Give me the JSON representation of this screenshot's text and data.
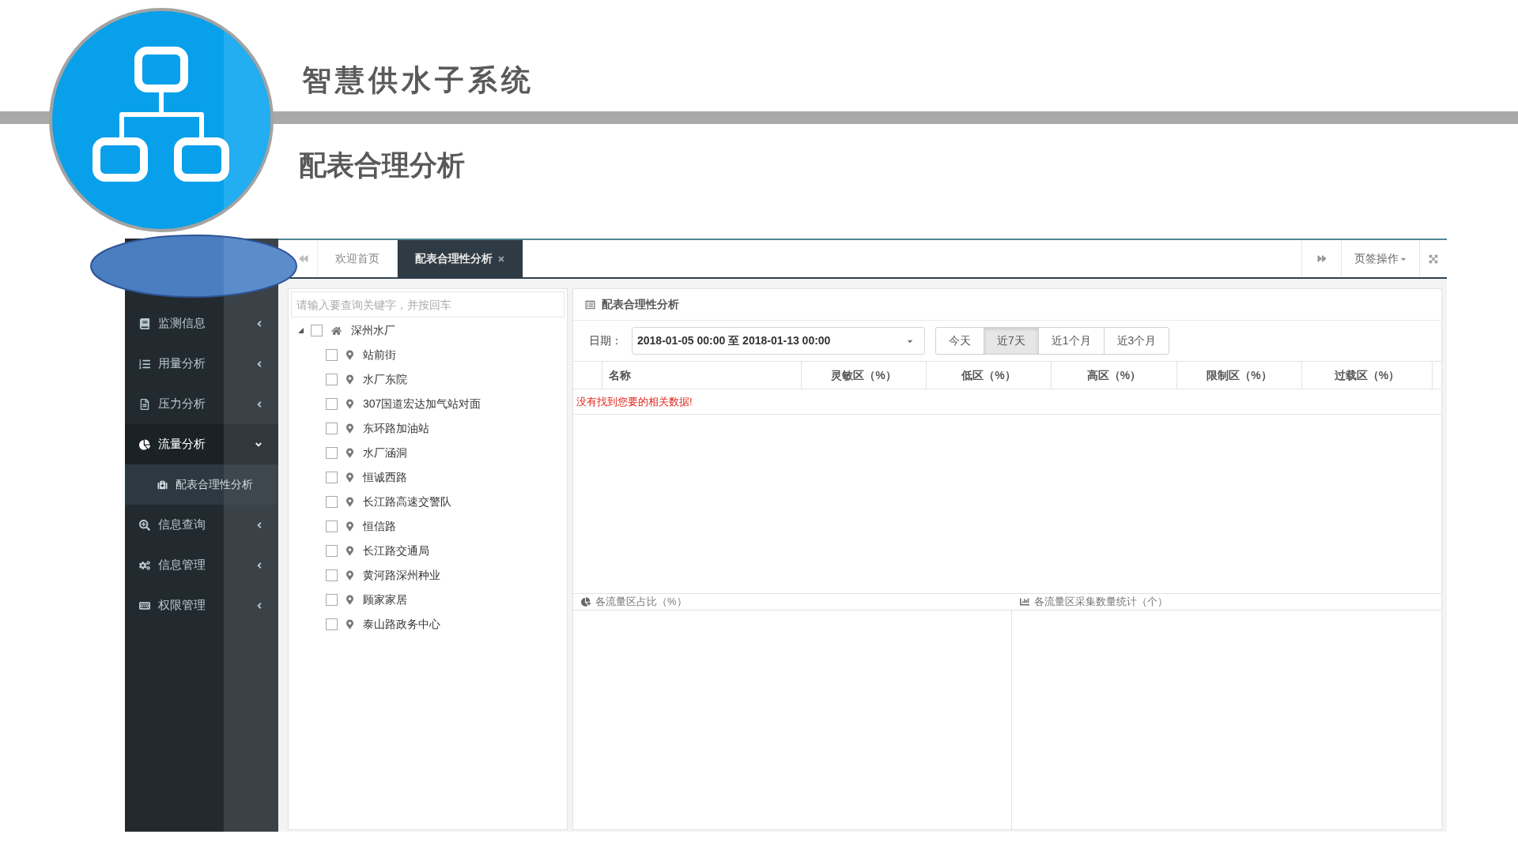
{
  "header": {
    "title": "智慧供水子系统",
    "subtitle": "配表合理分析"
  },
  "sidebar": {
    "items": [
      {
        "label": "监测信息",
        "expanded": false
      },
      {
        "label": "用量分析",
        "expanded": false
      },
      {
        "label": "压力分析",
        "expanded": false
      },
      {
        "label": "流量分析",
        "expanded": true,
        "children": [
          {
            "label": "配表合理性分析",
            "selected": true
          }
        ]
      },
      {
        "label": "信息查询",
        "expanded": false
      },
      {
        "label": "信息管理",
        "expanded": false
      },
      {
        "label": "权限管理",
        "expanded": false
      }
    ]
  },
  "tabs": [
    {
      "label": "欢迎首页",
      "selected": false
    },
    {
      "label": "配表合理性分析",
      "selected": true
    }
  ],
  "tab_actions": {
    "menu_label": "页签操作"
  },
  "tree": {
    "search": {
      "placeholder": "请输入要查询关键字，并按回车"
    },
    "nodes": [
      {
        "label": "深州水厂",
        "expanded": true,
        "checked": false,
        "children": [
          {
            "label": "站前街",
            "checked": false
          },
          {
            "label": "水厂东院",
            "checked": false
          },
          {
            "label": "307国道宏达加气站对面",
            "checked": false
          },
          {
            "label": "东环路加油站",
            "checked": false
          },
          {
            "label": "水厂涵洞",
            "checked": false
          },
          {
            "label": "恒诚西路",
            "checked": false
          },
          {
            "label": "长江路高速交警队",
            "checked": false
          },
          {
            "label": "恒信路",
            "checked": false
          },
          {
            "label": "长江路交通局",
            "checked": false
          },
          {
            "label": "黄河路深州种业",
            "checked": false
          },
          {
            "label": "顾家家居",
            "checked": false
          },
          {
            "label": "泰山路政务中心",
            "checked": false
          }
        ]
      }
    ]
  },
  "panel": {
    "title": "配表合理性分析",
    "date_label": "日期：",
    "date_value": "2018-01-05 00:00 至 2018-01-13 00:00",
    "ranges": [
      {
        "label": "今天",
        "selected": false
      },
      {
        "label": "近7天",
        "selected": true
      },
      {
        "label": "近1个月",
        "selected": false
      },
      {
        "label": "近3个月",
        "selected": false
      }
    ],
    "table": {
      "columns": [
        "名称",
        "灵敏区（%）",
        "低区（%）",
        "高区（%）",
        "限制区（%）",
        "过载区（%）"
      ],
      "empty_message": "没有找到您要的相关数据!"
    }
  },
  "charts": [
    {
      "title": "各流量区占比（%）"
    },
    {
      "title": "各流量区采集数量统计（个）"
    }
  ]
}
